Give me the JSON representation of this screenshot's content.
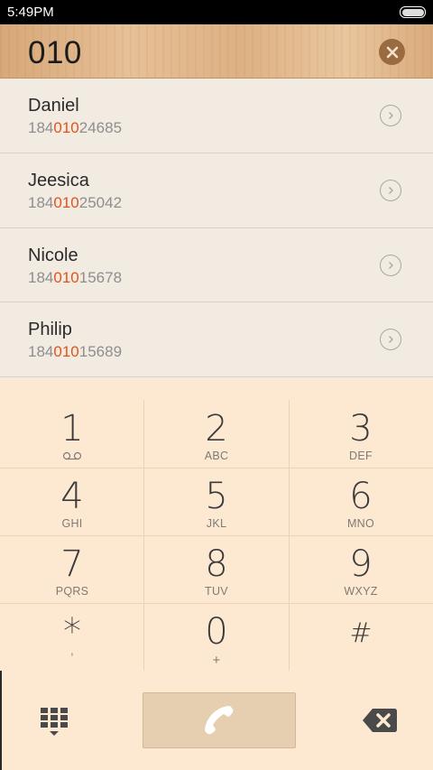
{
  "status_bar": {
    "time": "5:49PM"
  },
  "search": {
    "query": "010"
  },
  "results": [
    {
      "name": "Daniel",
      "number_pre": "184",
      "number_match": "010",
      "number_post": "24685"
    },
    {
      "name": "Jeesica",
      "number_pre": "184",
      "number_match": "010",
      "number_post": "25042"
    },
    {
      "name": "Nicole",
      "number_pre": "184",
      "number_match": "010",
      "number_post": "15678"
    },
    {
      "name": "Philip",
      "number_pre": "184",
      "number_match": "010",
      "number_post": "15689"
    }
  ],
  "keypad": [
    {
      "digit": "1",
      "letters": "",
      "icon": "voicemail-icon"
    },
    {
      "digit": "2",
      "letters": "ABC"
    },
    {
      "digit": "3",
      "letters": "DEF"
    },
    {
      "digit": "4",
      "letters": "GHI"
    },
    {
      "digit": "5",
      "letters": "JKL"
    },
    {
      "digit": "6",
      "letters": "MNO"
    },
    {
      "digit": "7",
      "letters": "PQRS"
    },
    {
      "digit": "8",
      "letters": "TUV"
    },
    {
      "digit": "9",
      "letters": "WXYZ"
    },
    {
      "digit": "*",
      "letters": ","
    },
    {
      "digit": "0",
      "letters": "+"
    },
    {
      "digit": "#",
      "letters": ""
    }
  ],
  "colors": {
    "match_highlight": "#e0541c",
    "wood_header": "#ddb183",
    "dialpad_bg": "#fde9d1"
  },
  "icons": {
    "clear": "close-circle-icon",
    "row_detail": "chevron-right-circle-icon",
    "dialpad_toggle": "dialpad-grid-icon",
    "call": "phone-handset-icon",
    "delete": "backspace-icon"
  }
}
